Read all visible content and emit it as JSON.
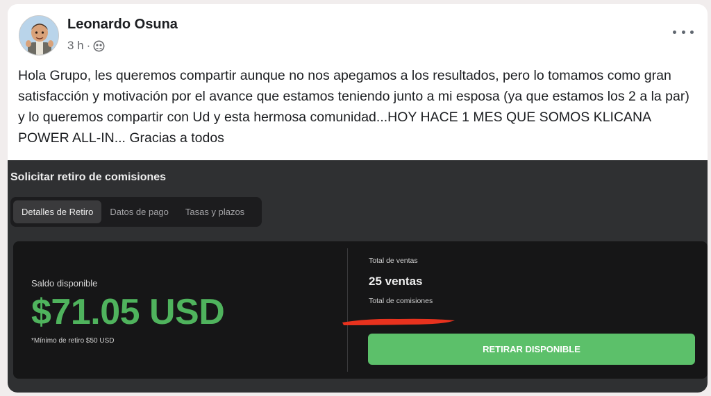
{
  "post": {
    "author": "Leonardo Osuna",
    "time": "3 h",
    "separator": "·",
    "audience_icon": "friends-icon",
    "body": "Hola Grupo, les queremos compartir aunque no nos apegamos a los resultados, pero lo tomamos como gran satisfacción y motivación por el avance que estamos teniendo junto a mi esposa (ya que estamos los 2 a la par) y lo queremos compartir con Ud y esta hermosa comunidad...HOY HACE 1 MES QUE SOMOS KLICANA POWER ALL-IN... Gracias a todos"
  },
  "screenshot": {
    "title": "Solicitar retiro de comisiones",
    "tabs": [
      {
        "label": "Detalles de Retiro",
        "active": true
      },
      {
        "label": "Datos de pago",
        "active": false
      },
      {
        "label": "Tasas y plazos",
        "active": false
      }
    ],
    "saldo_label": "Saldo disponible",
    "saldo_amount": "$71.05 USD",
    "minimo_note": "*Mínimo de retiro $50 USD",
    "total_ventas_label": "Total de ventas",
    "total_ventas_value": "25 ventas",
    "total_comisiones_label": "Total de comisiones",
    "retirar_button": "RETIRAR DISPONIBLE"
  },
  "colors": {
    "accent_green": "#4fb35d",
    "button_green": "#5cc06a",
    "red_mark": "#e8321e",
    "panel_bg": "#161617",
    "screenshot_bg": "#2f3032"
  }
}
